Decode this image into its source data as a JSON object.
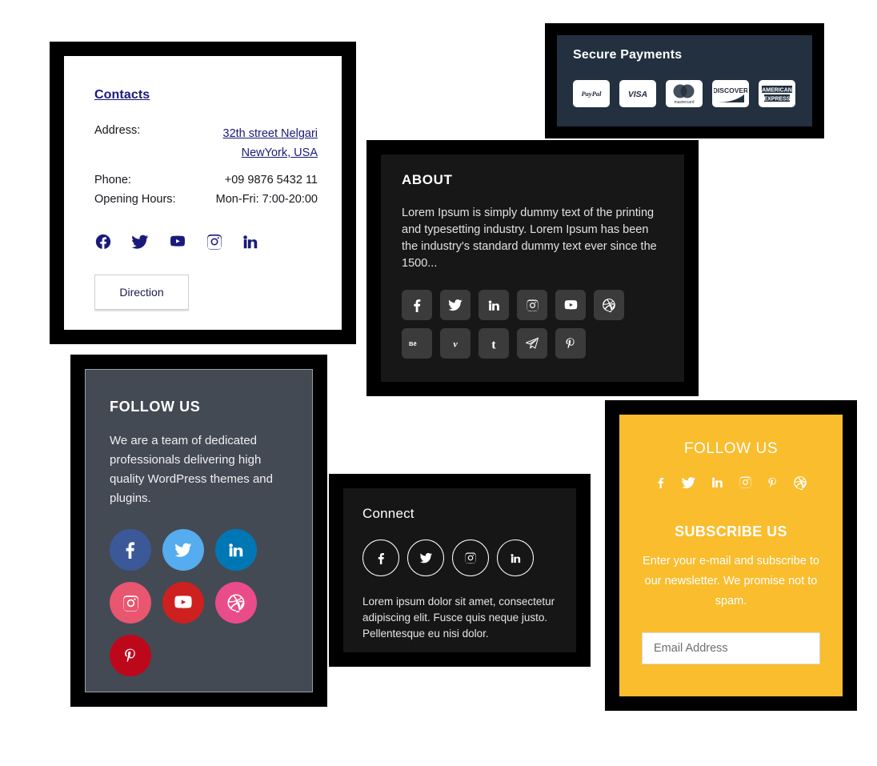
{
  "contacts": {
    "title": "Contacts",
    "address_label": "Address:",
    "address_line1": "32th street Nelgari",
    "address_line2": "NewYork, USA",
    "phone_label": "Phone:",
    "phone_value": "+09 9876 5432 11",
    "hours_label": "Opening Hours:",
    "hours_value": "Mon-Fri: 7:00-20:00",
    "direction_label": "Direction",
    "link_color": "#1a1a7a",
    "social": [
      {
        "name": "facebook-icon"
      },
      {
        "name": "twitter-icon"
      },
      {
        "name": "youtube-icon"
      },
      {
        "name": "instagram-icon"
      },
      {
        "name": "linkedin-icon"
      }
    ]
  },
  "payments": {
    "title": "Secure Payments",
    "panel_color": "#22303f",
    "methods": [
      {
        "name": "paypal-logo",
        "label": "PayPal"
      },
      {
        "name": "visa-logo",
        "label": "VISA"
      },
      {
        "name": "mastercard-logo",
        "label": "mastercard"
      },
      {
        "name": "discover-logo",
        "label": "DISCOVER"
      },
      {
        "name": "amex-logo",
        "label": "AMERICAN EXPRESS"
      }
    ]
  },
  "about": {
    "title": "ABOUT",
    "text": "Lorem Ipsum is simply dummy text of the printing and typesetting industry. Lorem Ipsum has been the industry's standard dummy text ever since the 1500...",
    "social_row1": [
      {
        "name": "facebook-icon"
      },
      {
        "name": "twitter-icon"
      },
      {
        "name": "linkedin-icon"
      },
      {
        "name": "instagram-icon"
      },
      {
        "name": "youtube-icon"
      },
      {
        "name": "dribbble-icon"
      }
    ],
    "social_row2": [
      {
        "name": "behance-icon"
      },
      {
        "name": "vimeo-icon"
      },
      {
        "name": "tumblr-icon"
      },
      {
        "name": "telegram-icon"
      },
      {
        "name": "pinterest-icon"
      }
    ]
  },
  "followus": {
    "title": "FOLLOW US",
    "text": "We are a team of dedicated professionals delivering high quality WordPress themes and plugins.",
    "panel_color": "#434a54",
    "social_row1": [
      {
        "name": "facebook-icon",
        "color": "#3b5998"
      },
      {
        "name": "twitter-icon",
        "color": "#55acee"
      },
      {
        "name": "linkedin-icon",
        "color": "#0077b5"
      }
    ],
    "social_row2": [
      {
        "name": "instagram-icon",
        "color": "#e8566f"
      },
      {
        "name": "youtube-icon",
        "color": "#cd201f"
      },
      {
        "name": "dribbble-icon",
        "color": "#ea4c89"
      }
    ],
    "social_row3": [
      {
        "name": "pinterest-icon",
        "color": "#bd081c"
      }
    ]
  },
  "connect": {
    "title": "Connect",
    "text": "Lorem ipsum dolor sit amet, consectetur adipiscing elit. Fusce quis neque justo. Pellentesque eu nisi dolor.",
    "social": [
      {
        "name": "facebook-icon"
      },
      {
        "name": "twitter-icon"
      },
      {
        "name": "instagram-icon"
      },
      {
        "name": "linkedin-icon"
      }
    ]
  },
  "subscribe": {
    "follow_title": "FOLLOW US",
    "subscribe_title": "SUBSCRIBE US",
    "text": "Enter your e-mail and subscribe to our newsletter. We promise not to spam.",
    "email_placeholder": "Email Address",
    "email_value": "",
    "panel_color": "#f9bd2e",
    "social": [
      {
        "name": "facebook-icon"
      },
      {
        "name": "twitter-icon"
      },
      {
        "name": "linkedin-icon"
      },
      {
        "name": "instagram-icon"
      },
      {
        "name": "pinterest-icon"
      },
      {
        "name": "dribbble-icon"
      }
    ]
  }
}
